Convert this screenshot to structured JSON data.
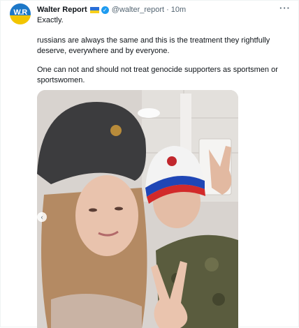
{
  "tweet": {
    "display_name": "Walter Report",
    "avatar_text": "W.R",
    "verified_icon": "verified-badge-icon",
    "flag_icon": "ukraine-flag-icon",
    "handle": "@walter_report",
    "separator": "·",
    "time": "10m",
    "more_icon": "more-options-icon",
    "more_glyph": "···",
    "paragraphs": [
      "Exactly.",
      "russians are always the same and this is the treatment they rightfully deserve, everywhere and by everyone.",
      "One can not and should not treat genocide supporters as sportsmen or sportswomen."
    ]
  },
  "media": {
    "type": "photo",
    "subject": "selfie-two-people",
    "nav_icon": "chevron-left-icon",
    "nav_glyph": "‹"
  },
  "colors": {
    "text": "#0f1419",
    "secondary": "#536471",
    "verified": "#1d9bf0",
    "flag_blue": "#2a6fd6",
    "flag_yellow": "#f7cf1c"
  }
}
